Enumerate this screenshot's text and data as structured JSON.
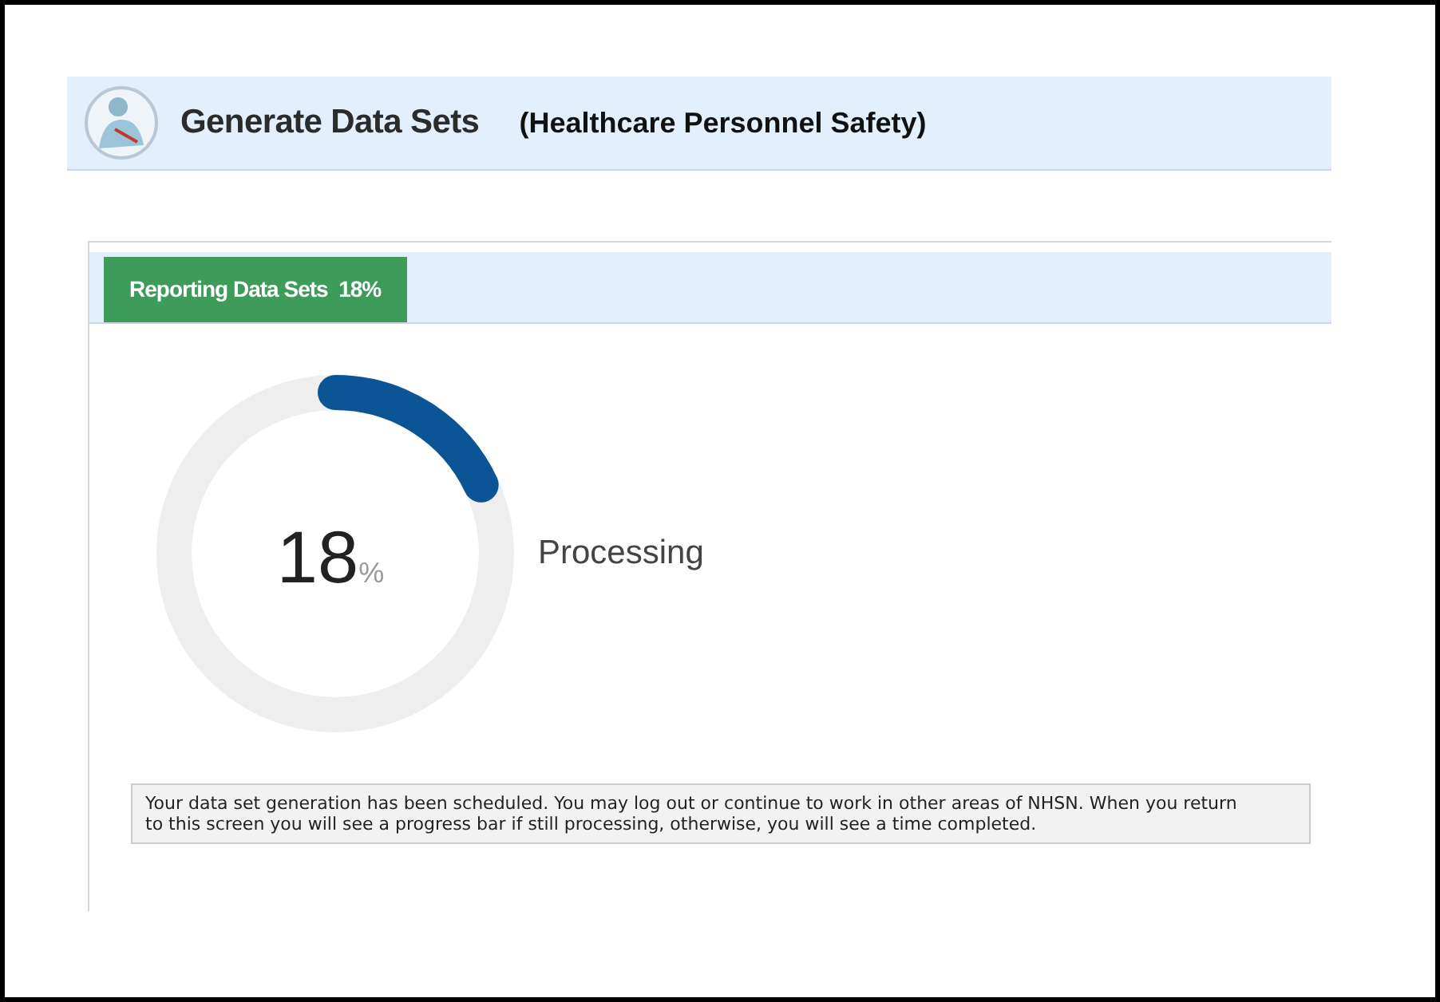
{
  "header": {
    "title": "Generate Data Sets",
    "subtitle": "(Healthcare Personnel Safety)"
  },
  "panel": {
    "tabs": [
      {
        "label": "Reporting Data Sets  18%",
        "selected": true
      }
    ],
    "progress": {
      "value": "18",
      "unit": "%",
      "status": "Processing"
    },
    "note": "Your data set generation has been scheduled. You may log out or continue to work in other areas of NHSN. When you return to this screen you will see a progress bar if still processing, otherwise, you will see a time completed."
  }
}
